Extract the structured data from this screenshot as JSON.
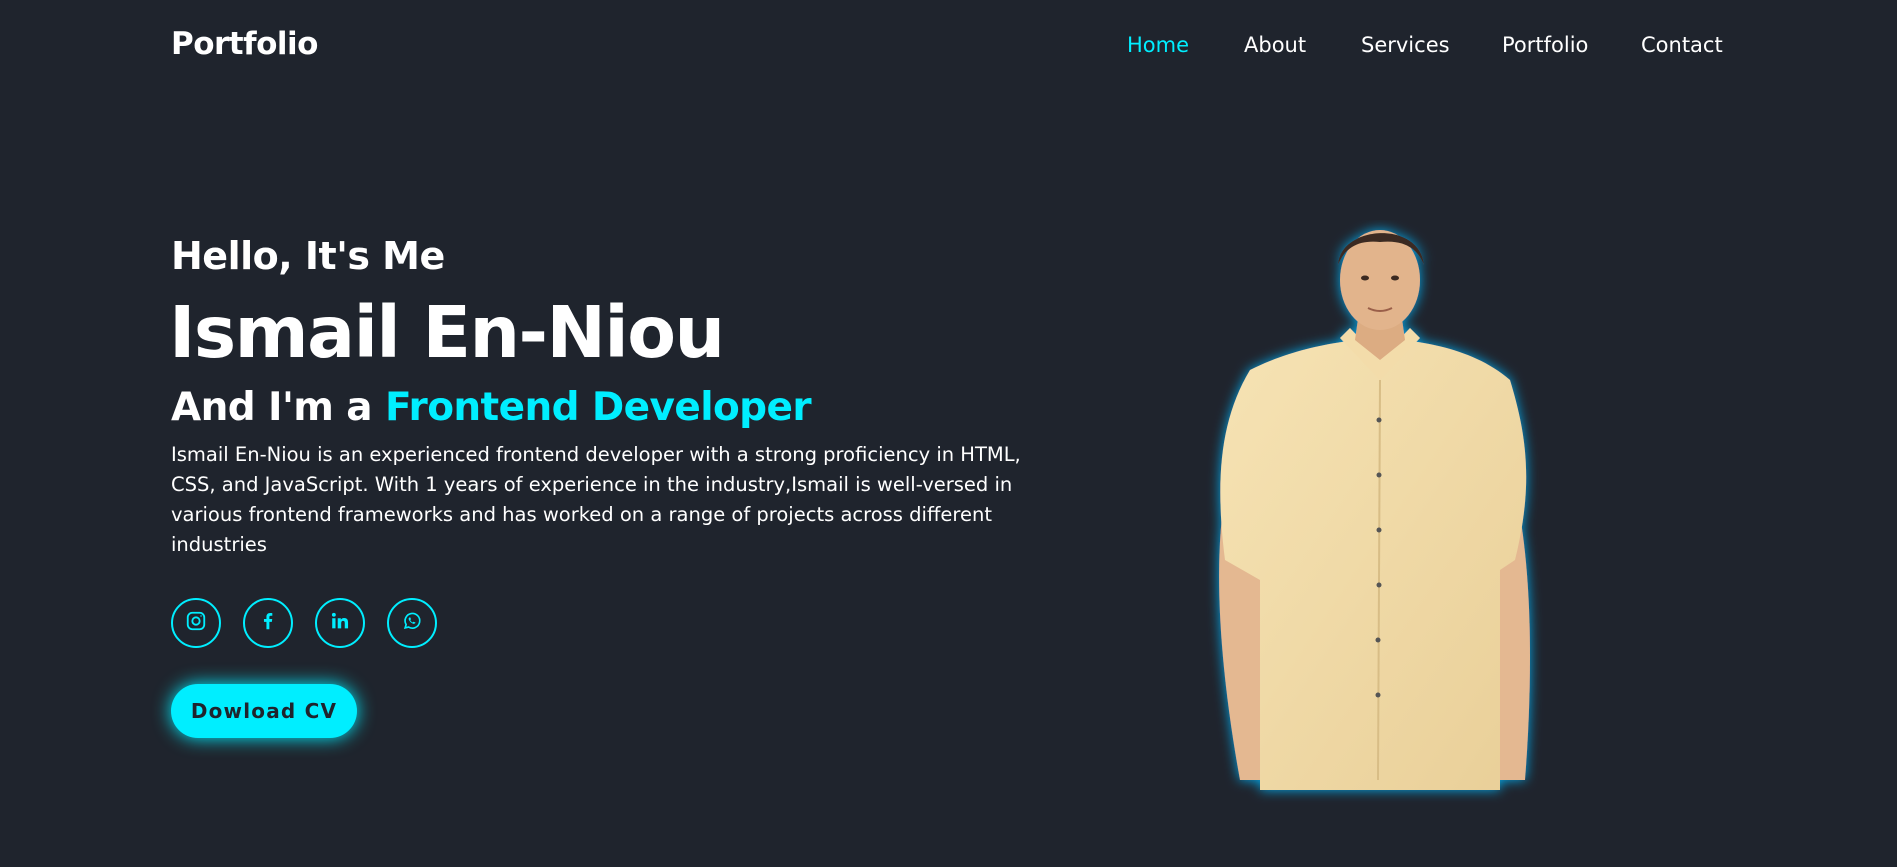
{
  "header": {
    "logo": "Portfolio",
    "nav": [
      {
        "label": "Home",
        "active": true
      },
      {
        "label": "About",
        "active": false
      },
      {
        "label": "Services",
        "active": false
      },
      {
        "label": "Portfolio",
        "active": false
      },
      {
        "label": "Contact",
        "active": false
      }
    ]
  },
  "hero": {
    "greeting": "Hello, It's Me",
    "name": "Ismail En-Niou",
    "role_prefix": "And I'm a",
    "role_accent": "Frontend Developer",
    "description": "Ismail En-Niou is an experienced frontend developer with a strong proficiency in HTML, CSS, and JavaScript. With 1 years of experience in the industry,Ismail is well-versed in various frontend frameworks and has worked on a range of projects across different industries",
    "socials": [
      {
        "icon": "instagram-icon"
      },
      {
        "icon": "facebook-icon"
      },
      {
        "icon": "linkedin-icon"
      },
      {
        "icon": "whatsapp-icon"
      }
    ],
    "cv_button": "Dowload CV"
  },
  "colors": {
    "background": "#1f242d",
    "accent": "#00eeff",
    "text": "#ffffff"
  }
}
